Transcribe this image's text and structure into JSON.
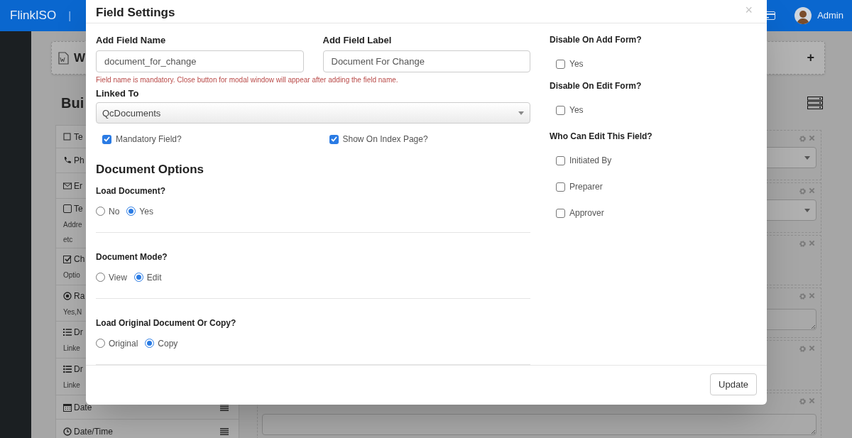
{
  "top_bar": {
    "brand": "FlinkISO",
    "separator": "|",
    "user": "Admin"
  },
  "background": {
    "card_title": "W",
    "card_add": "+",
    "heading": "Bui",
    "field_types": [
      {
        "kind": "text",
        "label": "Te",
        "handle": false
      },
      {
        "kind": "phone",
        "label": "Ph",
        "handle": false
      },
      {
        "kind": "email",
        "label": "Er",
        "handle": false
      },
      {
        "kind": "textarea",
        "label": "Te",
        "notes": [
          "Addre",
          "etc"
        ],
        "handle": false
      },
      {
        "kind": "checkbox",
        "label": "Ch",
        "notes": [
          "Optio"
        ],
        "handle": false
      },
      {
        "kind": "radio",
        "label": "Ra",
        "notes": [
          "Yes,N"
        ],
        "handle": false
      },
      {
        "kind": "ordered-list",
        "label": "Dr",
        "notes": [
          "Linke"
        ],
        "handle": false
      },
      {
        "kind": "list",
        "label": "Dr",
        "notes": [
          "Linke"
        ],
        "handle": false
      },
      {
        "kind": "date",
        "label": "Date",
        "handle": true
      },
      {
        "kind": "time",
        "label": "Date/Time",
        "handle": true
      }
    ],
    "fields": [
      {
        "kind": "select"
      },
      {
        "kind": "select"
      },
      {
        "kind": "empty"
      },
      {
        "kind": "textarea"
      },
      {
        "kind": "empty"
      },
      {
        "kind": "textarea"
      }
    ]
  },
  "modal": {
    "title": "Field Settings",
    "close": "×",
    "field_name": {
      "label": "Add Field Name",
      "value": "document_for_change"
    },
    "field_label": {
      "label": "Add Field Label",
      "value": "Document For Change"
    },
    "error": "Field name is mandatory. Close button for modal window will appear after adding the field name.",
    "linked_to": {
      "label": "Linked To",
      "value": "QcDocuments"
    },
    "flags": [
      {
        "label": "Mandatory Field?",
        "checked": true
      },
      {
        "label": "Show On Index Page?",
        "checked": true
      }
    ],
    "section_title": "Document Options",
    "radio_groups": [
      {
        "label": "Load Document?",
        "options": [
          {
            "label": "No",
            "selected": false
          },
          {
            "label": "Yes",
            "selected": true
          }
        ]
      },
      {
        "label": "Document Mode?",
        "options": [
          {
            "label": "View",
            "selected": false
          },
          {
            "label": "Edit",
            "selected": true
          }
        ]
      },
      {
        "label": "Load Original Document Or Copy?",
        "options": [
          {
            "label": "Original",
            "selected": false
          },
          {
            "label": "Copy",
            "selected": true
          }
        ]
      }
    ],
    "side_groups": [
      {
        "label": "Disable On Add Form?",
        "options": [
          {
            "label": "Yes",
            "checked": false
          }
        ]
      },
      {
        "label": "Disable On Edit Form?",
        "options": [
          {
            "label": "Yes",
            "checked": false
          }
        ]
      },
      {
        "label": "Who Can Edit This Field?",
        "options": [
          {
            "label": "Initiated By",
            "checked": false
          },
          {
            "label": "Preparer",
            "checked": false
          },
          {
            "label": "Approver",
            "checked": false
          }
        ]
      }
    ],
    "update_button": "Update"
  }
}
